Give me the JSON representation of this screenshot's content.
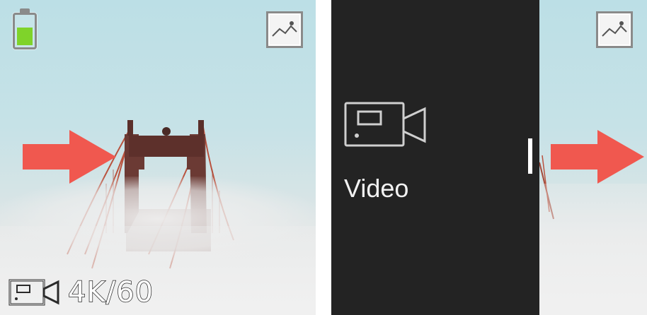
{
  "left_screen": {
    "battery": {
      "icon": "battery-icon",
      "level": 0.62,
      "fill_color": "#7fd32a"
    },
    "gallery_icon": "gallery-icon",
    "mode": {
      "icon": "video-camera-icon",
      "value": "4K/60"
    },
    "arrow_color": "#f0584f"
  },
  "right_screen": {
    "menu": {
      "icon": "video-camera-icon",
      "label": "Video"
    },
    "gallery_icon": "gallery-icon",
    "arrow_color": "#f0584f"
  }
}
